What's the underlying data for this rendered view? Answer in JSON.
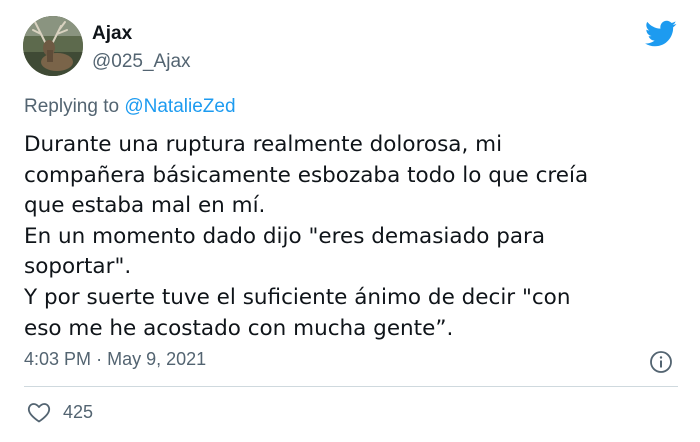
{
  "author": {
    "display_name": "Ajax",
    "handle": "@025_Ajax",
    "avatar_icon": "elk-avatar"
  },
  "brand": {
    "icon": "twitter-bird-icon",
    "color": "#1d9bf0"
  },
  "reply": {
    "prefix": "Replying to",
    "mention": "@NatalieZed"
  },
  "tweet": {
    "lines": [
      "Durante una ruptura realmente dolorosa, mi",
      "compañera básicamente esbozaba todo lo que creía",
      "que estaba mal en mí.",
      "En un momento dado dijo \"eres demasiado para",
      "soportar\".",
      "Y por suerte tuve el suficiente ánimo de decir \"con",
      "eso me he acostado con mucha gente”."
    ]
  },
  "meta": {
    "time": "4:03 PM",
    "separator": "·",
    "date": "May 9, 2021",
    "info_icon": "info-icon"
  },
  "engagement": {
    "like_icon": "heart-icon",
    "likes": "425"
  },
  "colors": {
    "text_primary": "#0f1419",
    "text_secondary": "#536471",
    "link": "#1d9bf0",
    "divider": "#cfd9de"
  }
}
